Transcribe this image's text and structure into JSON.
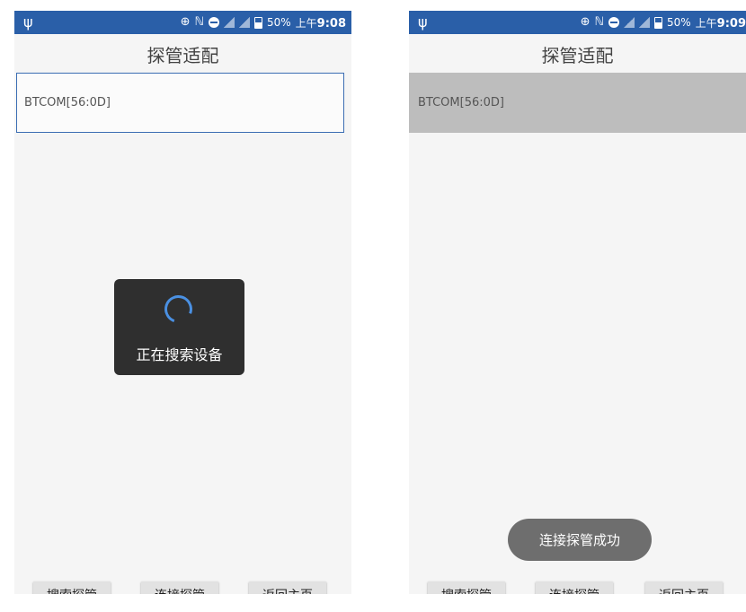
{
  "statusbar_left": {
    "battery": "50%",
    "time_prefix": "上午",
    "time": "9:08"
  },
  "statusbar_right": {
    "battery": "50%",
    "time_prefix": "上午",
    "time": "9:09"
  },
  "screen_left": {
    "title": "探管适配",
    "device_item": "BTCOM[56:0D]",
    "loading_text": "正在搜索设备"
  },
  "screen_right": {
    "title": "探管适配",
    "device_item": "BTCOM[56:0D]",
    "toast_text": "连接探管成功"
  },
  "buttons": {
    "search": "搜索探管",
    "connect": "连接探管",
    "home": "返回主页"
  },
  "colors": {
    "statusbar": "#2a5fa8",
    "spinner": "#4a90e2",
    "selected_row": "#bdbdbd",
    "list_border": "#3b6db3"
  },
  "icons": [
    "usb-icon",
    "gps-icon",
    "nfc-icon",
    "do-not-disturb-icon",
    "signal-icon",
    "battery-icon"
  ]
}
